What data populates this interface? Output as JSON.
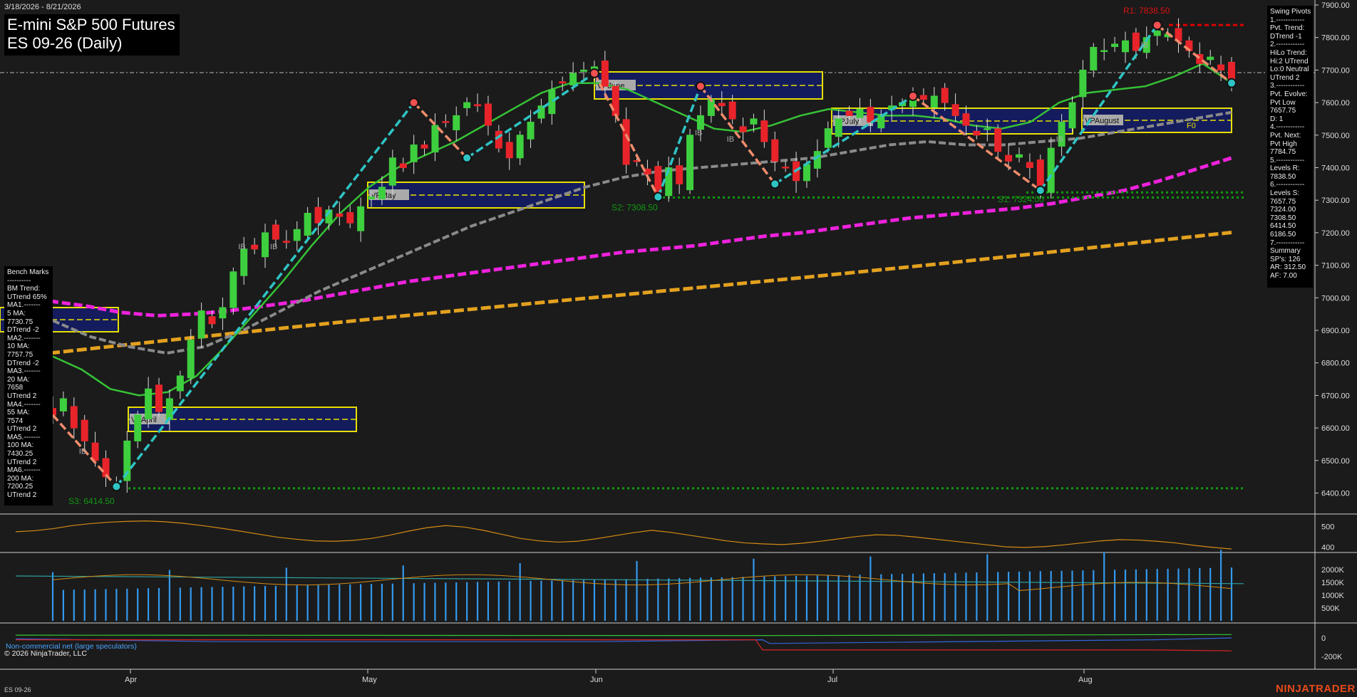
{
  "header": {
    "date_range": "3/18/2026 - 8/21/2026",
    "title_line1": "E-mini S&P 500 Futures",
    "title_line2": "ES 09-26 (Daily)"
  },
  "swing_panel": [
    "Swing Pivots",
    "1.------------",
    "Pvt. Trend:",
    "DTrend -1",
    "2.------------",
    "HiLo Trend:",
    "Hi:2 UTrend",
    "Lo:0 Neutral",
    "UTrend 2",
    "3.------------",
    "Pvt. Evolve:",
    "Pvt Low",
    "7657.75",
    "D: 1",
    "4.------------",
    "Pvt. Next:",
    "Pvt High",
    "7784.75",
    "5.------------",
    "Levels R:",
    "7838.50",
    "6.------------",
    "Levels S:",
    "7657.75",
    "7324.00",
    "7308.50",
    "6414.50",
    "6186.50",
    "7.------------",
    "Summary",
    "SP's: 126",
    "AR: 312.50",
    "AF: 7.00"
  ],
  "bench_panel": [
    "Bench Marks",
    "----------",
    "BM Trend:",
    "UTrend 65%",
    "MA1.-------",
    "5 MA:",
    "7730.75",
    "DTrend -2",
    "MA2.-------",
    "10 MA:",
    "7757.75",
    "DTrend -2",
    "MA3.-------",
    "20 MA:",
    "7658",
    "UTrend 2",
    "MA4.-------",
    "55 MA:",
    "7574",
    "UTrend 2",
    "MA5.-------",
    "100 MA:",
    "7430.25",
    "UTrend 2",
    "MA6.-------",
    "200 MA:",
    "7200.25",
    "UTrend 2"
  ],
  "labels": {
    "r1": "R1: 7838.50",
    "s1": "S1: 7324.00",
    "s2": "S2: 7308.50",
    "s3": "S3: 6414.50",
    "vp_april": "VPApril",
    "vp_may": "VPMay",
    "vp_june": "VPJune",
    "vp_july": "VPJuly",
    "vp_august": "VPAugust",
    "fo": "F0",
    "ib": "IB",
    "copyright": "© 2026 NinjaTrader, LLC",
    "cot_label": "Non-commercial net (large speculators)",
    "symbol_footer": "ES 09-26",
    "brand": "NINJATRADER"
  },
  "colors": {
    "up_candle": "#3ecf3e",
    "down_candle": "#e8242a",
    "ma_green": "#36c236",
    "ma_gray": "#8a8a8a",
    "ma_magenta": "#ee22dd",
    "ma_orange": "#e3a11f",
    "swing_up": "#2fc4c4",
    "swing_down": "#f08c6c",
    "vp_fill": "#141c5e",
    "vp_border": "#e8e000",
    "support_dots": "#119911",
    "resist_dots": "#dd0000",
    "volume_bar": "#3399ee",
    "brand": "#e84a1a"
  },
  "chart_data": [
    {
      "type": "candlestick",
      "title": "E-mini S&P 500 Futures ES 09-26 (Daily)",
      "x_ticks": [
        "Apr",
        "May",
        "Jun",
        "Jul",
        "Aug"
      ],
      "y_ticks": [
        "6400.00",
        "6500.00",
        "6600.00",
        "6700.00",
        "6800.00",
        "6900.00",
        "7000.00",
        "7100.00",
        "7200.00",
        "7300.00",
        "7400.00",
        "7500.00",
        "7600.00",
        "7700.00",
        "7800.00",
        "7900.00"
      ],
      "ylim": [
        6340,
        7910
      ],
      "close_path": [
        6640,
        6690,
        6600,
        6560,
        6500,
        6450,
        6420,
        6560,
        6640,
        6720,
        6650,
        6690,
        6760,
        6870,
        6960,
        6920,
        6970,
        7080,
        7150,
        7150,
        7200,
        7180,
        7170,
        7210,
        7260,
        7230,
        7270,
        7250,
        7230,
        7280,
        7310,
        7340,
        7430,
        7400,
        7470,
        7460,
        7530,
        7540,
        7560,
        7600,
        7590,
        7530,
        7460,
        7430,
        7500,
        7540,
        7590,
        7640,
        7660,
        7690,
        7700,
        7710,
        7650,
        7560,
        7410,
        7420,
        7380,
        7320,
        7400,
        7350,
        7500,
        7560,
        7610,
        7590,
        7550,
        7510,
        7550,
        7480,
        7420,
        7400,
        7360,
        7410,
        7450,
        7520,
        7550,
        7560,
        7580,
        7540,
        7560,
        7590,
        7600,
        7610,
        7610,
        7620,
        7600,
        7560,
        7530,
        7500,
        7520,
        7450,
        7420,
        7440,
        7400,
        7330,
        7460,
        7540,
        7600,
        7700,
        7770,
        7760,
        7780,
        7790,
        7760,
        7800,
        7820,
        7810,
        7790,
        7760,
        7720,
        7740,
        7700,
        7660
      ],
      "series": [
        {
          "name": "5 MA",
          "values": [
            7730.75
          ]
        },
        {
          "name": "10 MA",
          "values": [
            7757.75
          ]
        },
        {
          "name": "20 MA",
          "values": [
            7658
          ]
        },
        {
          "name": "55 MA",
          "values": [
            7574
          ]
        },
        {
          "name": "100 MA",
          "values": [
            7430.25
          ]
        },
        {
          "name": "200 MA",
          "values": [
            7200.25
          ]
        }
      ],
      "levels": {
        "R1": 7838.5,
        "S1": 7324.0,
        "S2": 7308.5,
        "S3": 6414.5
      }
    },
    {
      "type": "line",
      "title": "",
      "y_ticks": [
        "400",
        "500"
      ]
    },
    {
      "type": "bar",
      "title": "",
      "y_ticks": [
        "500K",
        "1000K",
        "1500K",
        "2000K"
      ]
    },
    {
      "type": "line",
      "title": "Non-commercial net (large speculators)",
      "y_ticks": [
        "0",
        "-200K"
      ]
    }
  ]
}
